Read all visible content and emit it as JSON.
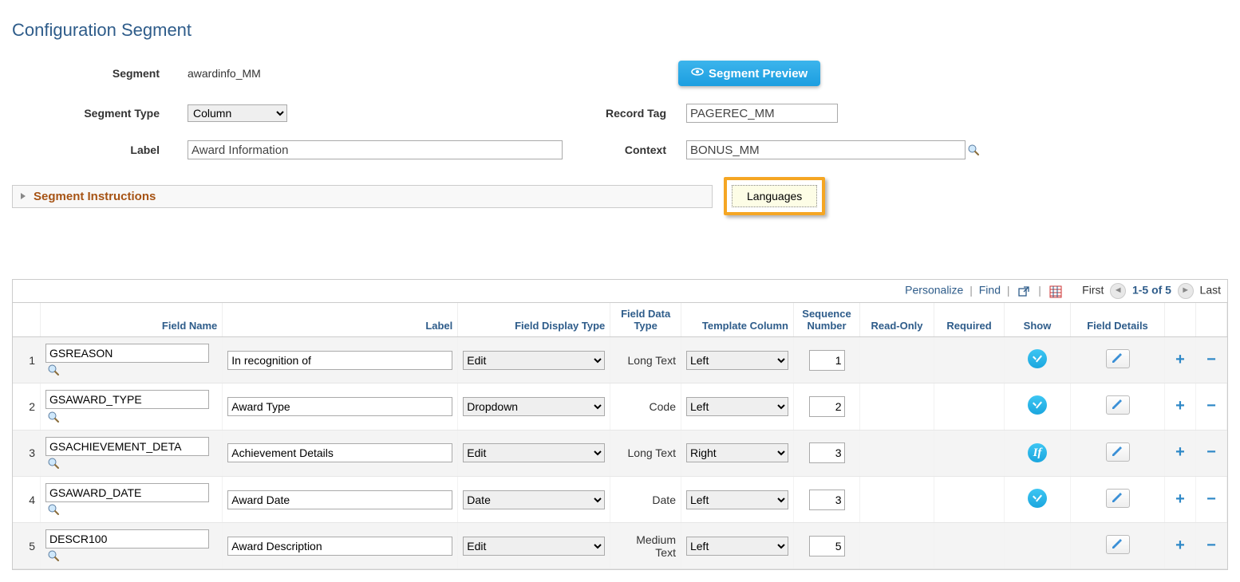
{
  "page_title": "Configuration Segment",
  "labels": {
    "segment": "Segment",
    "segment_type": "Segment Type",
    "record_tag": "Record Tag",
    "label": "Label",
    "context": "Context"
  },
  "values": {
    "segment": "awardinfo_MM",
    "segment_type": "Column",
    "record_tag": "PAGEREC_MM",
    "label": "Award Information",
    "context": "BONUS_MM"
  },
  "buttons": {
    "segment_preview": "Segment Preview",
    "languages": "Languages"
  },
  "segment_instructions_label": "Segment Instructions",
  "grid_toolbar": {
    "personalize": "Personalize",
    "find": "Find",
    "first": "First",
    "range": "1-5 of 5",
    "last": "Last"
  },
  "grid_headers": {
    "field_name": "Field Name",
    "label": "Label",
    "field_display_type": "Field Display Type",
    "field_data_type": "Field Data Type",
    "template_column": "Template Column",
    "sequence_number": "Sequence Number",
    "read_only": "Read-Only",
    "required": "Required",
    "show": "Show",
    "field_details": "Field Details"
  },
  "rows": [
    {
      "n": "1",
      "field_name": "GSREASON",
      "label": "In recognition of",
      "display_type": "Edit",
      "data_type": "Long Text",
      "template_col": "Left",
      "seq": "1",
      "show": "check"
    },
    {
      "n": "2",
      "field_name": "GSAWARD_TYPE",
      "label": "Award Type",
      "display_type": "Dropdown",
      "data_type": "Code",
      "template_col": "Left",
      "seq": "2",
      "show": "check"
    },
    {
      "n": "3",
      "field_name": "GSACHIEVEMENT_DETA",
      "label": "Achievement Details",
      "display_type": "Edit",
      "data_type": "Long Text",
      "template_col": "Right",
      "seq": "3",
      "show": "if"
    },
    {
      "n": "4",
      "field_name": "GSAWARD_DATE",
      "label": "Award Date",
      "display_type": "Date",
      "data_type": "Date",
      "template_col": "Left",
      "seq": "3",
      "show": "check"
    },
    {
      "n": "5",
      "field_name": "DESCR100",
      "label": "Award Description",
      "display_type": "Edit",
      "data_type": "Medium Text",
      "template_col": "Left",
      "seq": "5",
      "show": ""
    }
  ],
  "if_text": "If"
}
